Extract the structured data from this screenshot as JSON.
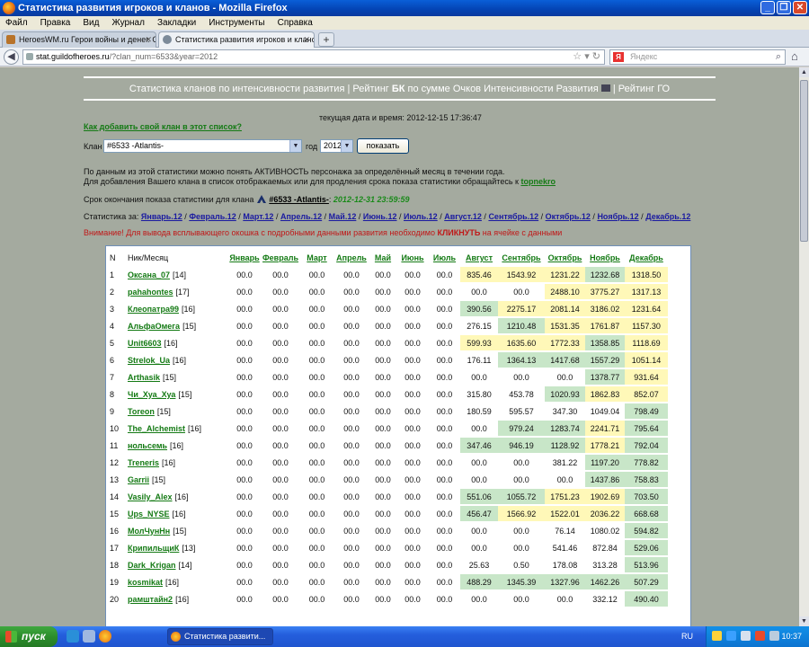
{
  "window": {
    "title": "Статистика развития игроков и кланов - Mozilla Firefox"
  },
  "menu": [
    "Файл",
    "Правка",
    "Вид",
    "Журнал",
    "Закладки",
    "Инструменты",
    "Справка"
  ],
  "tabs": [
    {
      "label": "HeroesWM.ru Герои войны и денег. Он..."
    },
    {
      "label": "Статистика развития игроков и кланов"
    }
  ],
  "nav": {
    "url_host": "stat.guildofheroes.ru",
    "url_path": "/?clan_num=6533&year=2012",
    "search_placeholder": "Яндекс"
  },
  "page": {
    "header_left": "Статистика кланов по интенсивности развития",
    "header_mid_pre": "Рейтинг ",
    "header_mid_bold": "БК",
    "header_mid_post": " по сумме Очков Интенсивности Развития",
    "header_right": "Рейтинг ГО",
    "current_date_label": "текущая дата и время: 2012-12-15 17:36:47",
    "add_clan_link": "Как добавить свой клан в этот список?",
    "clan_label": "Клан",
    "clan_select": "#6533 -Atlantis-",
    "year_label": "год",
    "year_select": "2012",
    "show_button": "показать",
    "info_line1": "По данным из этой статистики можно понять АКТИВНОСТЬ персонажа за определённый месяц в течении года.",
    "info_line2": "Для добавления Вашего клана в список отображаемых или для продления срока показа статистики обращайтесь к ",
    "info_contact": "topnekro",
    "expire_label": "Срок окончания показа статистики для клана",
    "expire_clan": "#6533 -Atlantis-",
    "expire_colon": ":",
    "expire_date": "2012-12-31 23:59:59",
    "stats_label": "Статистика за:",
    "stats_months": [
      "Январь.12",
      "Февраль.12",
      "Март.12",
      "Апрель.12",
      "Май.12",
      "Июнь.12",
      "Июль.12",
      "Август.12",
      "Сентябрь.12",
      "Октябрь.12",
      "Ноябрь.12",
      "Декабрь.12"
    ],
    "warning_pre": "Внимание! Для вывода всплывающего окошка с подробными данными развития необходимо ",
    "warning_bold": "КЛИКНУТЬ",
    "warning_post": " на ячейке с данными"
  },
  "table": {
    "col_n": "N",
    "col_nick": "Ник/Месяц",
    "months": [
      "Январь",
      "Февраль",
      "Март",
      "Апрель",
      "Май",
      "Июнь",
      "Июль",
      "Август",
      "Сентябрь",
      "Октябрь",
      "Ноябрь",
      "Декабрь"
    ],
    "rows": [
      {
        "n": "1",
        "name": "Оксана_07",
        "lvl": "[14]",
        "v": [
          "00.0",
          "00.0",
          "00.0",
          "00.0",
          "00.0",
          "00.0",
          "00.0",
          "835.46",
          "1543.92",
          "1231.22",
          "1232.68",
          "1318.50"
        ],
        "c": [
          "",
          "",
          "",
          "",
          "",
          "",
          "",
          "y",
          "y",
          "y",
          "g",
          "y"
        ]
      },
      {
        "n": "2",
        "name": "pahahontes",
        "lvl": "[17]",
        "v": [
          "00.0",
          "00.0",
          "00.0",
          "00.0",
          "00.0",
          "00.0",
          "00.0",
          "00.0",
          "00.0",
          "2488.10",
          "3775.27",
          "1317.13"
        ],
        "c": [
          "",
          "",
          "",
          "",
          "",
          "",
          "",
          "",
          "",
          "y",
          "y",
          "y"
        ]
      },
      {
        "n": "3",
        "name": "Клеопатра99",
        "lvl": "[16]",
        "v": [
          "00.0",
          "00.0",
          "00.0",
          "00.0",
          "00.0",
          "00.0",
          "00.0",
          "390.56",
          "2275.17",
          "2081.14",
          "3186.02",
          "1231.64"
        ],
        "c": [
          "",
          "",
          "",
          "",
          "",
          "",
          "",
          "g",
          "y",
          "y",
          "y",
          "y"
        ]
      },
      {
        "n": "4",
        "name": "АльфаОмега",
        "lvl": "[15]",
        "v": [
          "00.0",
          "00.0",
          "00.0",
          "00.0",
          "00.0",
          "00.0",
          "00.0",
          "276.15",
          "1210.48",
          "1531.35",
          "1761.87",
          "1157.30"
        ],
        "c": [
          "",
          "",
          "",
          "",
          "",
          "",
          "",
          "",
          "g",
          "y",
          "y",
          "y"
        ]
      },
      {
        "n": "5",
        "name": "Unit6603",
        "lvl": "[16]",
        "v": [
          "00.0",
          "00.0",
          "00.0",
          "00.0",
          "00.0",
          "00.0",
          "00.0",
          "599.93",
          "1635.60",
          "1772.33",
          "1358.85",
          "1118.69"
        ],
        "c": [
          "",
          "",
          "",
          "",
          "",
          "",
          "",
          "y",
          "y",
          "y",
          "g",
          "y"
        ]
      },
      {
        "n": "6",
        "name": "Strelok_Ua",
        "lvl": "[16]",
        "v": [
          "00.0",
          "00.0",
          "00.0",
          "00.0",
          "00.0",
          "00.0",
          "00.0",
          "176.11",
          "1364.13",
          "1417.68",
          "1557.29",
          "1051.14"
        ],
        "c": [
          "",
          "",
          "",
          "",
          "",
          "",
          "",
          "",
          "g",
          "g",
          "g",
          "y"
        ]
      },
      {
        "n": "7",
        "name": "Arthasik",
        "lvl": "[15]",
        "v": [
          "00.0",
          "00.0",
          "00.0",
          "00.0",
          "00.0",
          "00.0",
          "00.0",
          "00.0",
          "00.0",
          "00.0",
          "1378.77",
          "931.64"
        ],
        "c": [
          "",
          "",
          "",
          "",
          "",
          "",
          "",
          "",
          "",
          "",
          "g",
          "y"
        ]
      },
      {
        "n": "8",
        "name": "Чи_Хуа_Хуа",
        "lvl": "[15]",
        "v": [
          "00.0",
          "00.0",
          "00.0",
          "00.0",
          "00.0",
          "00.0",
          "00.0",
          "315.80",
          "453.78",
          "1020.93",
          "1862.83",
          "852.07"
        ],
        "c": [
          "",
          "",
          "",
          "",
          "",
          "",
          "",
          "",
          "",
          "g",
          "y",
          "y"
        ]
      },
      {
        "n": "9",
        "name": "Toreon",
        "lvl": "[15]",
        "v": [
          "00.0",
          "00.0",
          "00.0",
          "00.0",
          "00.0",
          "00.0",
          "00.0",
          "180.59",
          "595.57",
          "347.30",
          "1049.04",
          "798.49"
        ],
        "c": [
          "",
          "",
          "",
          "",
          "",
          "",
          "",
          "",
          "",
          "",
          "",
          "g"
        ]
      },
      {
        "n": "10",
        "name": "The_Alchemist",
        "lvl": "[16]",
        "v": [
          "00.0",
          "00.0",
          "00.0",
          "00.0",
          "00.0",
          "00.0",
          "00.0",
          "00.0",
          "979.24",
          "1283.74",
          "2241.71",
          "795.64"
        ],
        "c": [
          "",
          "",
          "",
          "",
          "",
          "",
          "",
          "",
          "g",
          "g",
          "y",
          "g"
        ]
      },
      {
        "n": "11",
        "name": "нольсемь",
        "lvl": "[16]",
        "v": [
          "00.0",
          "00.0",
          "00.0",
          "00.0",
          "00.0",
          "00.0",
          "00.0",
          "347.46",
          "946.19",
          "1128.92",
          "1778.21",
          "792.04"
        ],
        "c": [
          "",
          "",
          "",
          "",
          "",
          "",
          "",
          "g",
          "g",
          "g",
          "y",
          "g"
        ]
      },
      {
        "n": "12",
        "name": "Treneris",
        "lvl": "[16]",
        "v": [
          "00.0",
          "00.0",
          "00.0",
          "00.0",
          "00.0",
          "00.0",
          "00.0",
          "00.0",
          "00.0",
          "381.22",
          "1197.20",
          "778.82"
        ],
        "c": [
          "",
          "",
          "",
          "",
          "",
          "",
          "",
          "",
          "",
          "",
          "g",
          "g"
        ]
      },
      {
        "n": "13",
        "name": "Garrii",
        "lvl": "[15]",
        "v": [
          "00.0",
          "00.0",
          "00.0",
          "00.0",
          "00.0",
          "00.0",
          "00.0",
          "00.0",
          "00.0",
          "00.0",
          "1437.86",
          "758.83"
        ],
        "c": [
          "",
          "",
          "",
          "",
          "",
          "",
          "",
          "",
          "",
          "",
          "g",
          "g"
        ]
      },
      {
        "n": "14",
        "name": "Vasily_Alex",
        "lvl": "[16]",
        "v": [
          "00.0",
          "00.0",
          "00.0",
          "00.0",
          "00.0",
          "00.0",
          "00.0",
          "551.06",
          "1055.72",
          "1751.23",
          "1902.69",
          "703.50"
        ],
        "c": [
          "",
          "",
          "",
          "",
          "",
          "",
          "",
          "g",
          "g",
          "y",
          "y",
          "g"
        ]
      },
      {
        "n": "15",
        "name": "Ups_NYSE",
        "lvl": "[16]",
        "v": [
          "00.0",
          "00.0",
          "00.0",
          "00.0",
          "00.0",
          "00.0",
          "00.0",
          "456.47",
          "1566.92",
          "1522.01",
          "2036.22",
          "668.68"
        ],
        "c": [
          "",
          "",
          "",
          "",
          "",
          "",
          "",
          "g",
          "y",
          "y",
          "y",
          "g"
        ]
      },
      {
        "n": "16",
        "name": "МолЧунНн",
        "lvl": "[15]",
        "v": [
          "00.0",
          "00.0",
          "00.0",
          "00.0",
          "00.0",
          "00.0",
          "00.0",
          "00.0",
          "00.0",
          "76.14",
          "1080.02",
          "594.82"
        ],
        "c": [
          "",
          "",
          "",
          "",
          "",
          "",
          "",
          "",
          "",
          "",
          "",
          "g"
        ]
      },
      {
        "n": "17",
        "name": "КрипильщиК",
        "lvl": "[13]",
        "v": [
          "00.0",
          "00.0",
          "00.0",
          "00.0",
          "00.0",
          "00.0",
          "00.0",
          "00.0",
          "00.0",
          "541.46",
          "872.84",
          "529.06"
        ],
        "c": [
          "",
          "",
          "",
          "",
          "",
          "",
          "",
          "",
          "",
          "",
          "",
          "g"
        ]
      },
      {
        "n": "18",
        "name": "Dark_Krigan",
        "lvl": "[14]",
        "v": [
          "00.0",
          "00.0",
          "00.0",
          "00.0",
          "00.0",
          "00.0",
          "00.0",
          "25.63",
          "0.50",
          "178.08",
          "313.28",
          "513.96"
        ],
        "c": [
          "",
          "",
          "",
          "",
          "",
          "",
          "",
          "",
          "",
          "",
          "",
          "g"
        ]
      },
      {
        "n": "19",
        "name": "kosmikat",
        "lvl": "[16]",
        "v": [
          "00.0",
          "00.0",
          "00.0",
          "00.0",
          "00.0",
          "00.0",
          "00.0",
          "488.29",
          "1345.39",
          "1327.96",
          "1462.26",
          "507.29"
        ],
        "c": [
          "",
          "",
          "",
          "",
          "",
          "",
          "",
          "g",
          "g",
          "g",
          "g",
          "g"
        ]
      },
      {
        "n": "20",
        "name": "рамштайн2",
        "lvl": "[16]",
        "v": [
          "00.0",
          "00.0",
          "00.0",
          "00.0",
          "00.0",
          "00.0",
          "00.0",
          "00.0",
          "00.0",
          "00.0",
          "332.12",
          "490.40"
        ],
        "c": [
          "",
          "",
          "",
          "",
          "",
          "",
          "",
          "",
          "",
          "",
          "",
          "g"
        ]
      }
    ]
  },
  "taskbar": {
    "start": "пуск",
    "task": "Статистика развити...",
    "lang": "RU",
    "clock": "10:37"
  }
}
